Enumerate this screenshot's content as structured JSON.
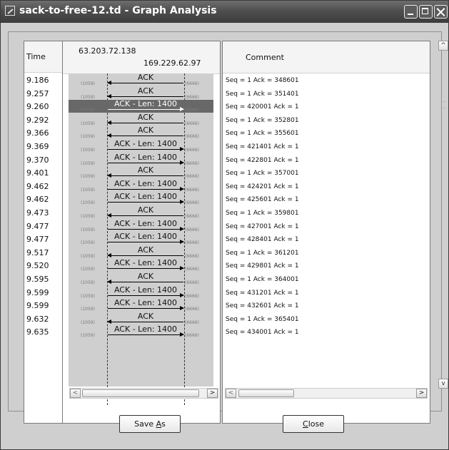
{
  "window": {
    "title": "sack-to-free-12.td - Graph Analysis"
  },
  "columns": {
    "time": "Time",
    "comment": "Comment"
  },
  "hosts": {
    "left": "63.203.72.138",
    "right": "169.229.62.97"
  },
  "ports": {
    "left": "(1059)",
    "right": "(6666)"
  },
  "rows": [
    {
      "time": "9.186",
      "label": "ACK",
      "dir": "left",
      "comment": "Seq = 1 Ack = 348601"
    },
    {
      "time": "9.257",
      "label": "ACK",
      "dir": "left",
      "comment": "Seq = 1 Ack = 351401"
    },
    {
      "time": "9.260",
      "label": "ACK - Len: 1400",
      "dir": "right",
      "comment": "Seq = 420001 Ack = 1",
      "selected": true
    },
    {
      "time": "9.292",
      "label": "ACK",
      "dir": "left",
      "comment": "Seq = 1 Ack = 352801"
    },
    {
      "time": "9.366",
      "label": "ACK",
      "dir": "left",
      "comment": "Seq = 1 Ack = 355601"
    },
    {
      "time": "9.369",
      "label": "ACK - Len: 1400",
      "dir": "right",
      "comment": "Seq = 421401 Ack = 1"
    },
    {
      "time": "9.370",
      "label": "ACK - Len: 1400",
      "dir": "right",
      "comment": "Seq = 422801 Ack = 1"
    },
    {
      "time": "9.401",
      "label": "ACK",
      "dir": "left",
      "comment": "Seq = 1 Ack = 357001"
    },
    {
      "time": "9.462",
      "label": "ACK - Len: 1400",
      "dir": "right",
      "comment": "Seq = 424201 Ack = 1"
    },
    {
      "time": "9.462",
      "label": "ACK - Len: 1400",
      "dir": "right",
      "comment": "Seq = 425601 Ack = 1"
    },
    {
      "time": "9.473",
      "label": "ACK",
      "dir": "left",
      "comment": "Seq = 1 Ack = 359801"
    },
    {
      "time": "9.477",
      "label": "ACK - Len: 1400",
      "dir": "right",
      "comment": "Seq = 427001 Ack = 1"
    },
    {
      "time": "9.477",
      "label": "ACK - Len: 1400",
      "dir": "right",
      "comment": "Seq = 428401 Ack = 1"
    },
    {
      "time": "9.517",
      "label": "ACK",
      "dir": "left",
      "comment": "Seq = 1 Ack = 361201"
    },
    {
      "time": "9.520",
      "label": "ACK - Len: 1400",
      "dir": "right",
      "comment": "Seq = 429801 Ack = 1"
    },
    {
      "time": "9.595",
      "label": "ACK",
      "dir": "left",
      "comment": "Seq = 1 Ack = 364001"
    },
    {
      "time": "9.599",
      "label": "ACK - Len: 1400",
      "dir": "right",
      "comment": "Seq = 431201 Ack = 1"
    },
    {
      "time": "9.599",
      "label": "ACK - Len: 1400",
      "dir": "right",
      "comment": "Seq = 432601 Ack = 1"
    },
    {
      "time": "9.632",
      "label": "ACK",
      "dir": "left",
      "comment": "Seq = 1 Ack = 365401"
    },
    {
      "time": "9.635",
      "label": "ACK - Len: 1400",
      "dir": "right",
      "comment": "Seq = 434001 Ack = 1"
    }
  ],
  "buttons": {
    "save_pre": "Save ",
    "save_key": "A",
    "save_post": "s",
    "close_key": "C",
    "close_post": "lose"
  },
  "scrollbars": {
    "thumb_grip": "III",
    "left_arrow": "<",
    "right_arrow": ">",
    "up_arrow": "^",
    "down_arrow": "v"
  },
  "icons": {
    "app": "graph-icon",
    "minimize": "minimize-icon",
    "maximize": "maximize-icon",
    "close": "close-icon"
  }
}
